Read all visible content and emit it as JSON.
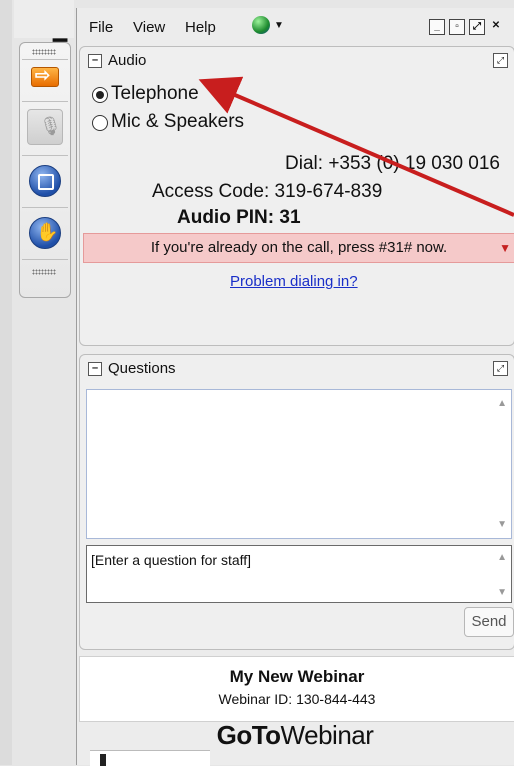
{
  "menu": {
    "file": "File",
    "view": "View",
    "help": "Help",
    "window_controls": [
      "minimize",
      "maximize",
      "popout",
      "close"
    ]
  },
  "toolbar": {
    "buttons": [
      "arrow-icon",
      "microphone-icon",
      "screen-icon",
      "raise-hand-icon"
    ]
  },
  "audio": {
    "title": "Audio",
    "options": [
      {
        "label": "Telephone",
        "selected": true
      },
      {
        "label": "Mic & Speakers",
        "selected": false
      }
    ],
    "dial": "Dial: +353 (0) 19 030 016",
    "access_code": "Access Code: 319-674-839",
    "audio_pin": "Audio PIN: 31",
    "warning": "If you're already on the call, press #31# now.",
    "problem_link": "Problem dialing in?"
  },
  "questions": {
    "title": "Questions",
    "input_placeholder": "[Enter a question for staff]",
    "send_label": "Send"
  },
  "webinar": {
    "title": "My New Webinar",
    "id_line": "Webinar ID: 130-844-443"
  },
  "brand": {
    "part1": "GoTo",
    "part2": "Webinar"
  },
  "colors": {
    "annotation_arrow": "#c81e1e",
    "warning_bg": "#f5c9c9",
    "link": "#1a2fc8"
  }
}
